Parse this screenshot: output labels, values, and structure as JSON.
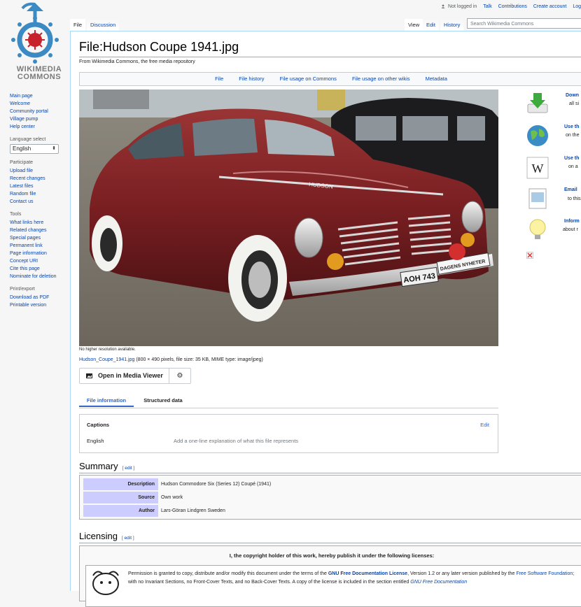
{
  "logo": {
    "line1": "WIKIMEDIA",
    "line2": "COMMONS"
  },
  "personal": {
    "not_logged_in": "Not logged in",
    "talk": "Talk",
    "contributions": "Contributions",
    "create_account": "Create account",
    "login": "Log"
  },
  "tabs": {
    "file": "File",
    "discussion": "Discussion",
    "view": "View",
    "edit": "Edit",
    "history": "History"
  },
  "search": {
    "placeholder": "Search Wikimedia Commons"
  },
  "sidebar": {
    "navigation": [
      "Main page",
      "Welcome",
      "Community portal",
      "Village pump",
      "Help center"
    ],
    "language_head": "Language select",
    "language_value": "English",
    "participate_head": "Participate",
    "participate": [
      "Upload file",
      "Recent changes",
      "Latest files",
      "Random file",
      "Contact us"
    ],
    "tools_head": "Tools",
    "tools": [
      "What links here",
      "Related changes",
      "Special pages",
      "Permanent link",
      "Page information",
      "Concept URI",
      "Cite this page",
      "Nominate for deletion"
    ],
    "print_head": "Print/export",
    "print": [
      "Download as PDF",
      "Printable version"
    ]
  },
  "page": {
    "title": "File:Hudson Coupe 1941.jpg",
    "sitesub": "From Wikimedia Commons, the free media repository"
  },
  "filetoc": [
    "File",
    "File history",
    "File usage on Commons",
    "File usage on other wikis",
    "Metadata"
  ],
  "image": {
    "no_higher": "No higher resolution available.",
    "filename": "Hudson_Coupe_1941.jpg",
    "details": " (800 × 490 pixels, file size: 35 KB, MIME type: image/jpeg)",
    "plate_left": "AOH 743",
    "plate_right": "DAGENS NYHETER",
    "hood_badge": "HUDSON"
  },
  "mmv": {
    "label": "Open in Media Viewer"
  },
  "infotabs": {
    "file_information": "File information",
    "structured_data": "Structured data"
  },
  "captions": {
    "heading": "Captions",
    "edit": "Edit",
    "language": "English",
    "placeholder": "Add a one-line explanation of what this file represents"
  },
  "summary": {
    "heading": "Summary",
    "edit": "edit",
    "rows": [
      {
        "key": "Description",
        "value": "Hudson Commodore Six (Series 12) Coupé (1941)"
      },
      {
        "key": "Source",
        "value": "Own work"
      },
      {
        "key": "Author",
        "value": "Lars-Göran Lindgren Sweden"
      }
    ]
  },
  "licensing": {
    "heading": "Licensing",
    "edit": "edit",
    "box_title": "I, the copyright holder of this work, hereby publish it under the following licenses:",
    "text_1": "Permission is granted to copy, distribute and/or modify this document under the terms of the ",
    "gfdl": "GNU Free Documentation License",
    "text_2": ", Version 1.2 or any later version published by the ",
    "fsf1": "Free",
    "fsf2": "Software Foundation",
    "text_3": "; with no Invariant Sections, no Front-Cover Texts, and no Back-Cover Texts. A copy of the license is included in the section entitled ",
    "gfdl_section": "GNU Free Documentation"
  },
  "right_column": [
    {
      "title": "Down",
      "sub": "all si"
    },
    {
      "title": "Use th",
      "sub": "on the"
    },
    {
      "title": "Use th",
      "sub": "on a"
    },
    {
      "title": "Email",
      "sub": "to this"
    },
    {
      "title": "Inform",
      "sub": "about r"
    }
  ],
  "colors": {
    "link": "#0645ad",
    "logo_blue": "#3b8ac4",
    "logo_red": "#c8232c",
    "summary_key_bg": "#ccccff",
    "car_maroon": "#7a1f22"
  }
}
